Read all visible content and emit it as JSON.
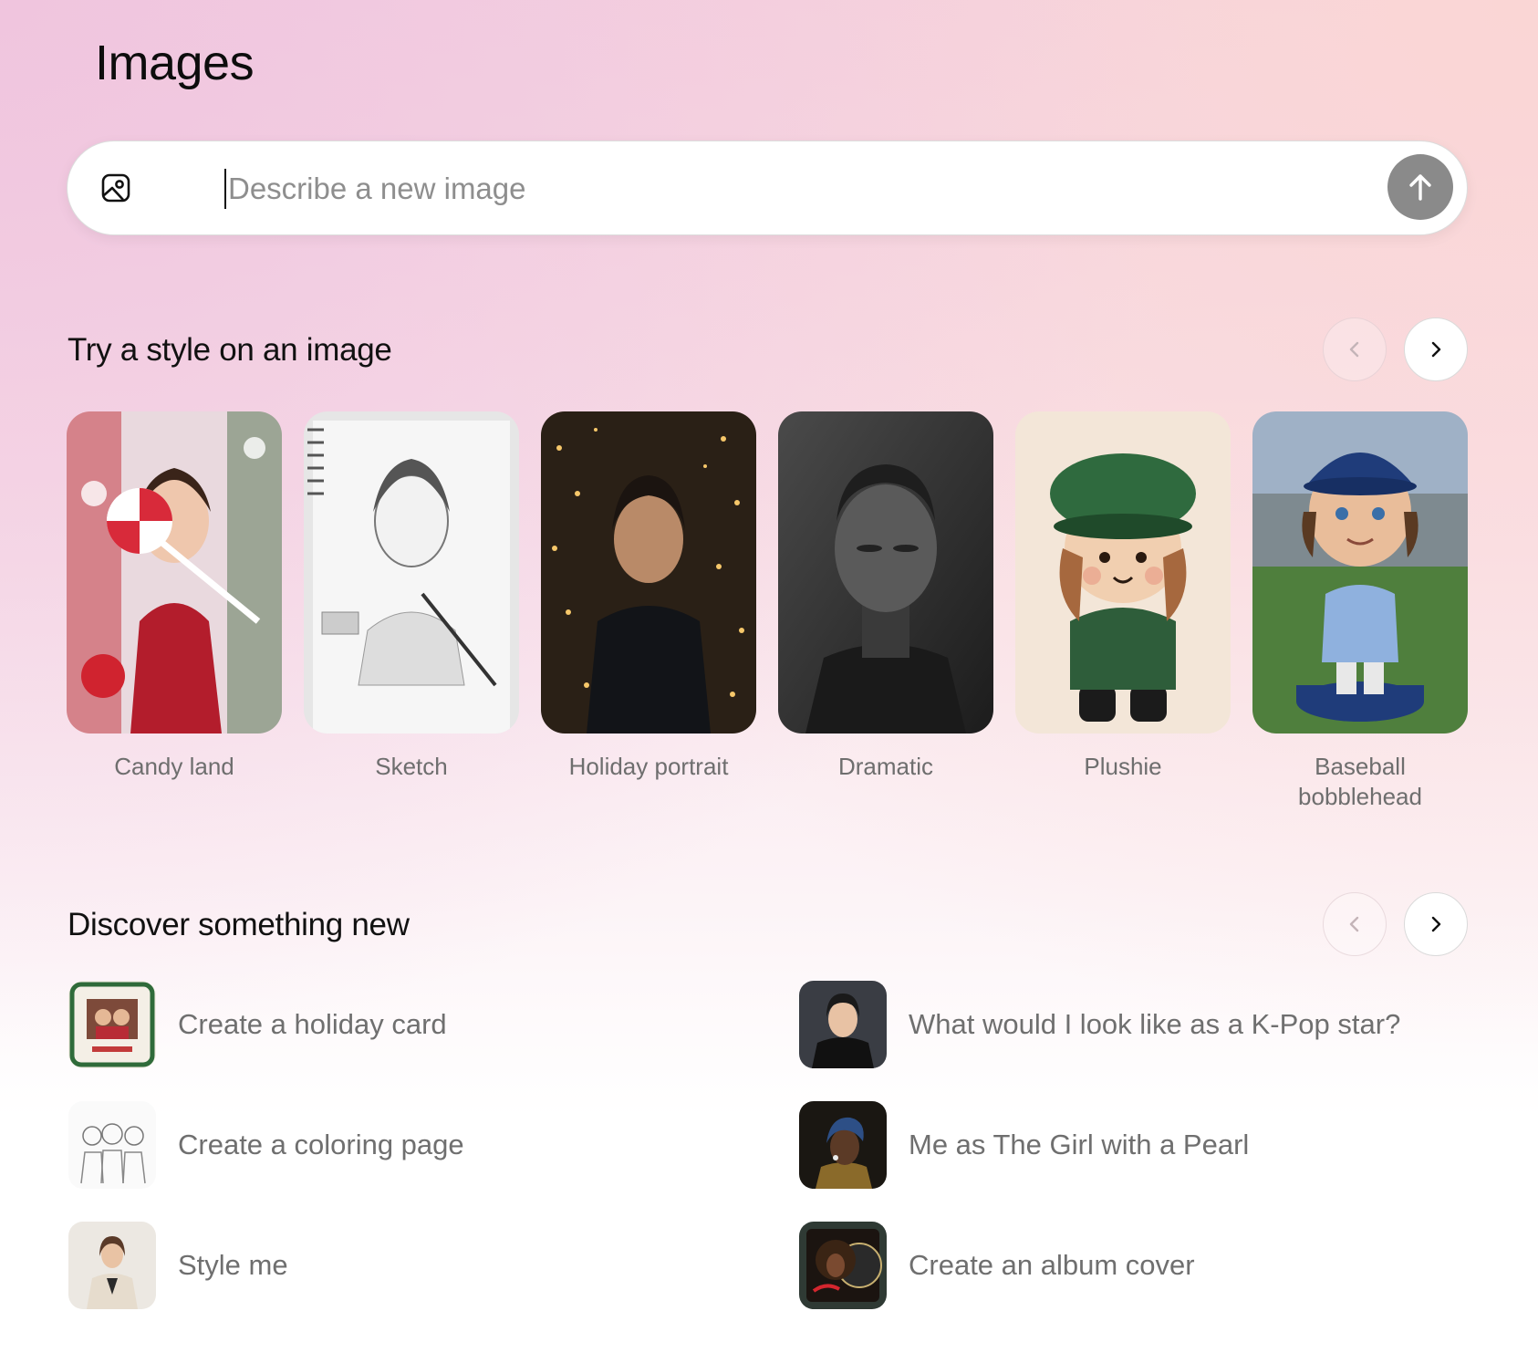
{
  "page": {
    "title": "Images"
  },
  "search": {
    "placeholder": "Describe a new image"
  },
  "styles_section": {
    "title": "Try a style on an image",
    "cards": [
      {
        "label": "Candy land"
      },
      {
        "label": "Sketch"
      },
      {
        "label": "Holiday portrait"
      },
      {
        "label": "Dramatic"
      },
      {
        "label": "Plushie"
      },
      {
        "label": "Baseball bobblehead"
      }
    ]
  },
  "discover_section": {
    "title": "Discover something new",
    "items": [
      {
        "label": "Create a holiday card"
      },
      {
        "label": "What would I look like as a K-Pop star?"
      },
      {
        "label": "Create a coloring page"
      },
      {
        "label": "Me as The Girl with a Pearl"
      },
      {
        "label": "Style me"
      },
      {
        "label": "Create an album cover"
      }
    ]
  },
  "colors": {
    "send_button": "#8a8a8a",
    "label_text": "#6e6e6e"
  }
}
